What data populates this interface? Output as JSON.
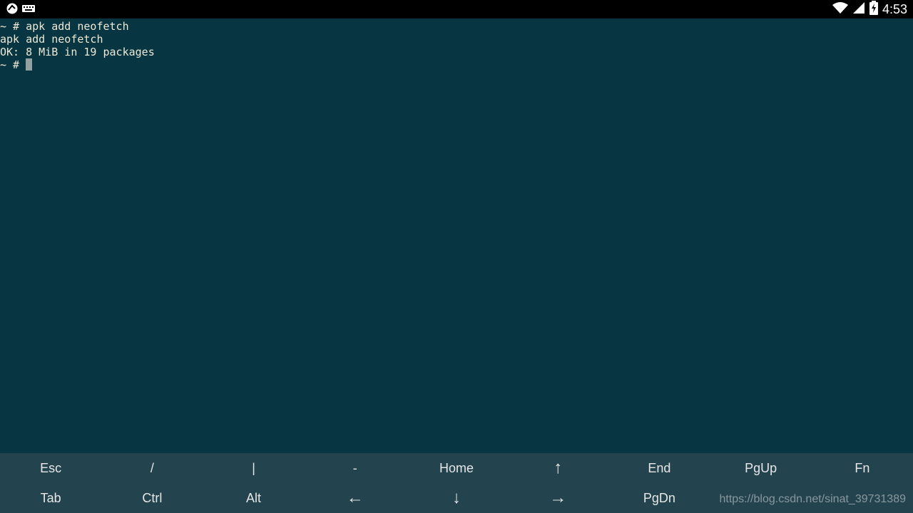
{
  "status_bar": {
    "time": "4:53",
    "left_icons": [
      "app-icon",
      "keyboard-icon"
    ],
    "right_icons": [
      "wifi-icon",
      "signal-icon",
      "battery-charging-icon"
    ]
  },
  "terminal": {
    "lines": [
      "~ # apk add neofetch",
      "apk add neofetch",
      "OK: 8 MiB in 19 packages"
    ],
    "prompt": "~ # "
  },
  "extra_keys": {
    "row1": [
      "Esc",
      "/",
      "|",
      "-",
      "Home",
      "↑",
      "End",
      "PgUp",
      "Fn"
    ],
    "row2": [
      "Tab",
      "Ctrl",
      "Alt",
      "←",
      "↓",
      "→",
      "PgDn",
      "",
      ""
    ]
  },
  "watermark": "https://blog.csdn.net/sinat_39731389",
  "colors": {
    "terminal_bg": "#073642",
    "terminal_fg": "#eee8d5",
    "extra_keys_bg": "#23444f",
    "status_bar_bg": "#000000"
  }
}
